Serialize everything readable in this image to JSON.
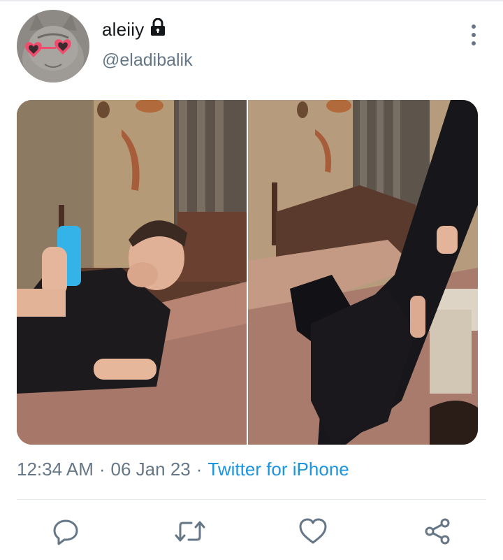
{
  "tweet": {
    "author": {
      "display_name": "aleiiy",
      "handle": "@eladibalik",
      "protected": true
    },
    "media": {
      "count": 2,
      "layout": "side-by-side"
    },
    "meta": {
      "time": "12:34 AM",
      "date": "06 Jan 23",
      "source": "Twitter for iPhone",
      "separator": "·"
    },
    "actions": [
      "reply",
      "retweet",
      "like",
      "share"
    ]
  },
  "icons": {
    "lock": "lock-icon",
    "more": "more-vertical-icon",
    "reply": "reply-icon",
    "retweet": "retweet-icon",
    "like": "heart-icon",
    "share": "share-icon"
  },
  "colors": {
    "text_primary": "#14171a",
    "text_secondary": "#657786",
    "link": "#1b95e0",
    "divider": "#e1e8ed"
  }
}
